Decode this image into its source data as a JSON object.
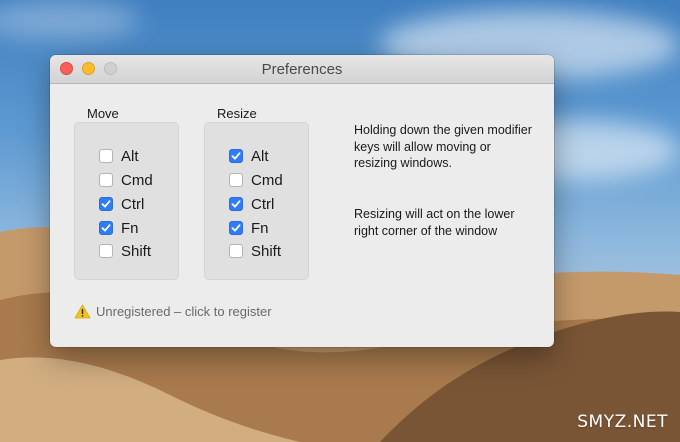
{
  "window": {
    "title": "Preferences"
  },
  "move": {
    "label": "Move",
    "options": [
      {
        "label": "Alt",
        "checked": false
      },
      {
        "label": "Cmd",
        "checked": false
      },
      {
        "label": "Ctrl",
        "checked": true
      },
      {
        "label": "Fn",
        "checked": true
      },
      {
        "label": "Shift",
        "checked": false
      }
    ]
  },
  "resize": {
    "label": "Resize",
    "options": [
      {
        "label": "Alt",
        "checked": true
      },
      {
        "label": "Cmd",
        "checked": false
      },
      {
        "label": "Ctrl",
        "checked": true
      },
      {
        "label": "Fn",
        "checked": true
      },
      {
        "label": "Shift",
        "checked": false
      }
    ]
  },
  "info": {
    "paragraph1": "Holding down the given modifier keys will allow moving or resizing windows.",
    "paragraph2": "Resizing will act on the lower right corner of the window"
  },
  "register": {
    "icon": "warning-icon",
    "text": "Unregistered – click to register"
  },
  "watermark": "SMYZ.NET",
  "colors": {
    "checkbox_checked": "#2f7cf6",
    "close": "#fc5f57",
    "minimize": "#fdbc2e",
    "zoom_disabled": "#d0d0d0",
    "warning": "#f5c518"
  }
}
